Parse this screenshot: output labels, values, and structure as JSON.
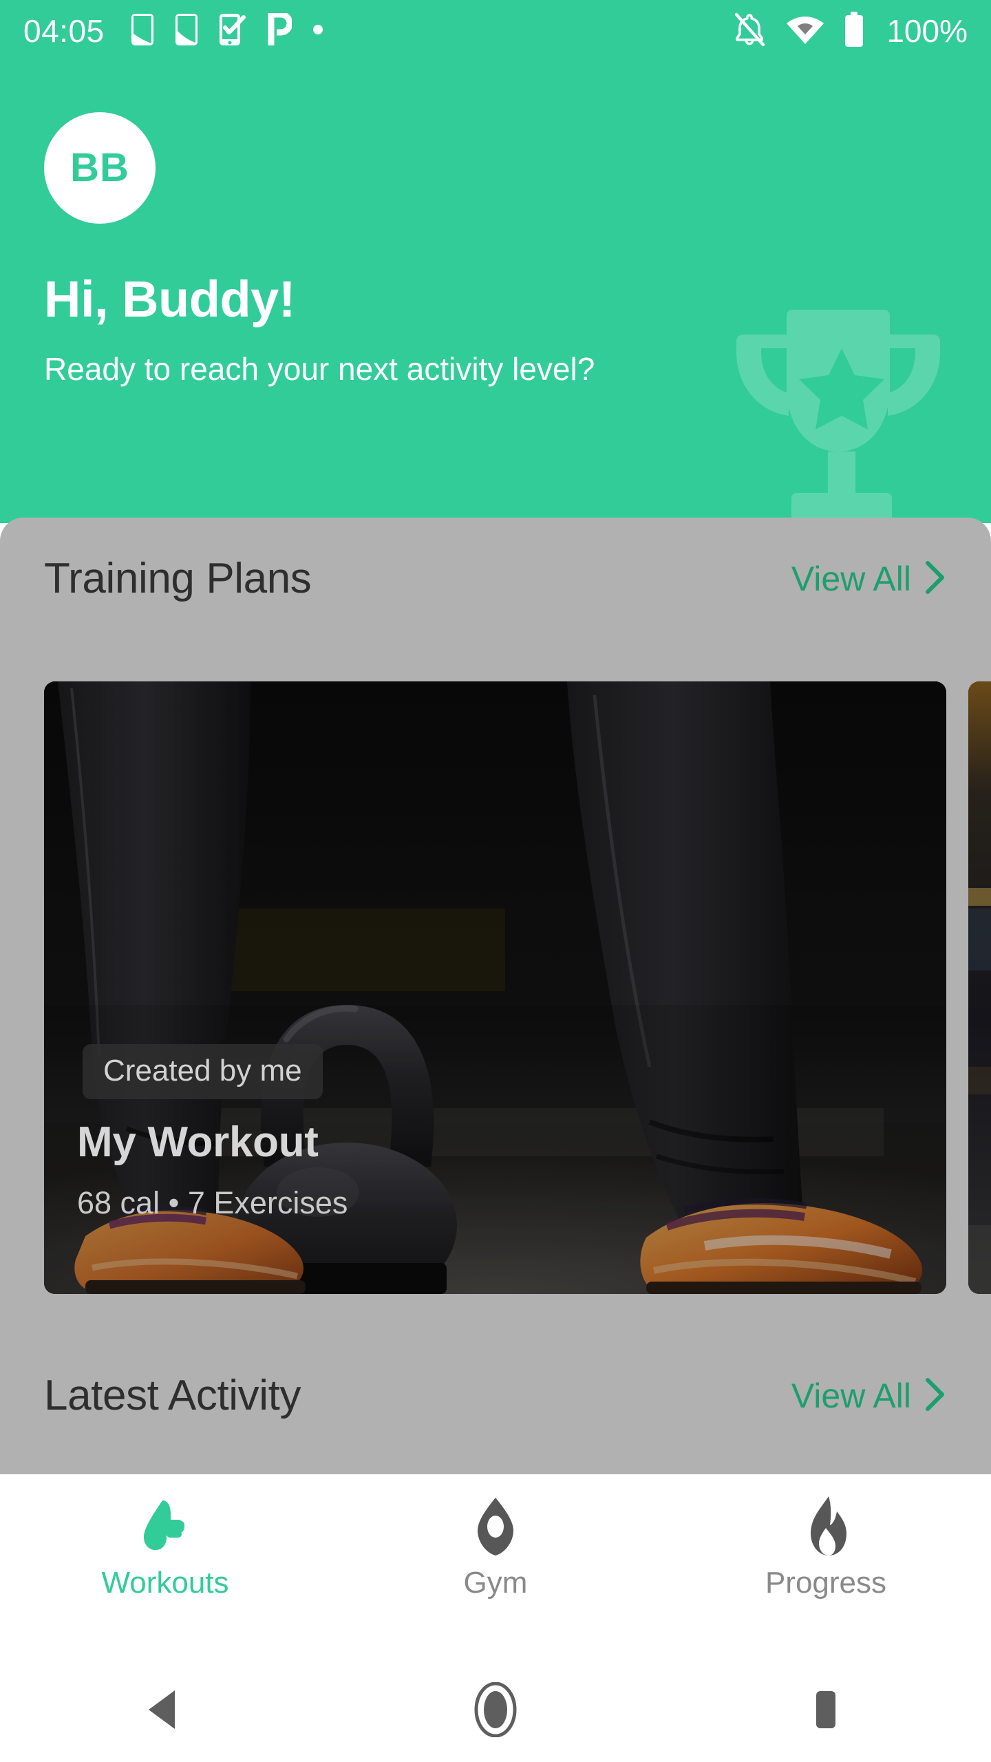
{
  "status_bar": {
    "clock": "04:05",
    "battery_percent": "100%",
    "left_icons": [
      "phone-signal-icon",
      "phone-signal-icon",
      "phone-check-icon",
      "p-logo-icon",
      "dot-icon"
    ],
    "right_icons": [
      "notifications-off-icon",
      "wifi-icon",
      "battery-full-icon"
    ]
  },
  "header": {
    "avatar_initials": "BB",
    "greeting_title": "Hi, Buddy!",
    "greeting_subtitle": "Ready to reach your next activity level?",
    "background_color": "#32cc98",
    "watermark_icon": "trophy-icon"
  },
  "training_plans": {
    "title": "Training Plans",
    "view_all_label": "View All",
    "view_all_icon": "chevron-right-icon",
    "cards": [
      {
        "badge": "Created by me",
        "title": "My Workout",
        "meta": "68 cal • 7 Exercises",
        "photo": "kettlebell-legs-photo"
      },
      {
        "badge": "",
        "title": "",
        "meta": "",
        "photo": "gym-photo"
      }
    ]
  },
  "latest_activity": {
    "title": "Latest Activity",
    "view_all_label": "View All",
    "view_all_icon": "chevron-right-icon"
  },
  "tab_bar": {
    "active_color": "#32cc98",
    "inactive_color": "#8a8a8a",
    "tabs": [
      {
        "label": "Workouts",
        "icon": "shoe-print-icon",
        "active": true
      },
      {
        "label": "Gym",
        "icon": "location-pin-icon",
        "active": false
      },
      {
        "label": "Progress",
        "icon": "flame-icon",
        "active": false
      }
    ]
  },
  "android_nav": {
    "buttons": [
      {
        "name": "back-button",
        "icon": "triangle-back-icon"
      },
      {
        "name": "home-button",
        "icon": "circle-home-icon"
      },
      {
        "name": "recents-button",
        "icon": "square-recents-icon"
      }
    ]
  }
}
